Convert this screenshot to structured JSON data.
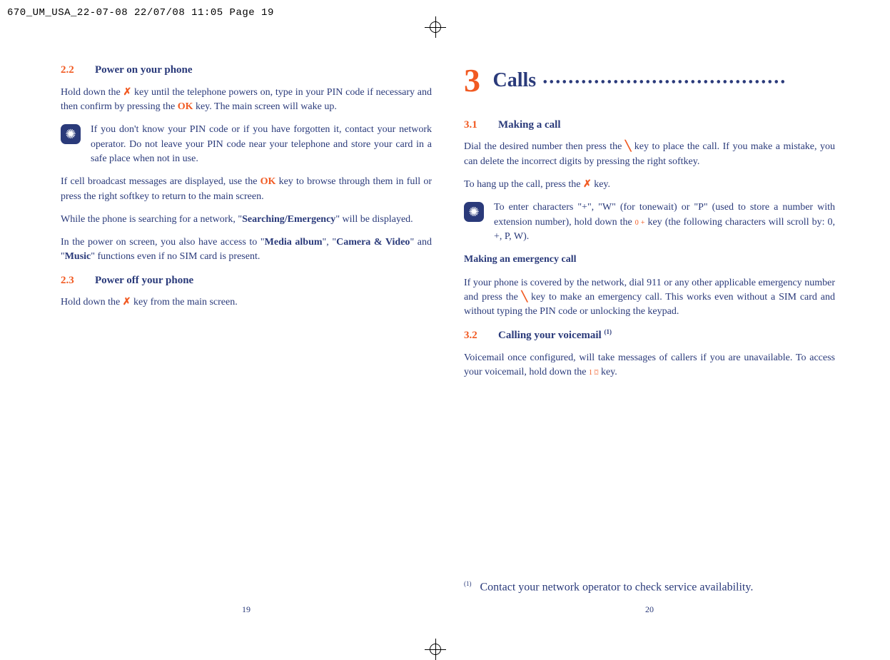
{
  "header": "670_UM_USA_22-07-08  22/07/08  11:05  Page 19",
  "left": {
    "s22": {
      "num": "2.2",
      "title": "Power on your phone",
      "p1a": "Hold down the ",
      "p1_key": "✗",
      "p1b": " key until the telephone powers on, type in your PIN code if necessary and then confirm by pressing the ",
      "p1_ok": "OK",
      "p1c": " key. The main screen will wake up.",
      "tip1": "If you don't know your PIN code or if you have forgotten it, contact your network operator. Do not leave your PIN code near your telephone and store your card in a safe place when not in use.",
      "p2a": "If cell broadcast messages are displayed, use the ",
      "p2_ok": "OK",
      "p2b": " key to browse through them in full or press the right softkey to return to the main screen.",
      "p3a": "While the phone is searching for a network, \"",
      "p3_bold": "Searching/Emergency",
      "p3b": "\" will be displayed.",
      "p4a": "In the power on screen, you also have access to \"",
      "p4_b1": "Media album",
      "p4b": "\", \"",
      "p4_b2": "Camera & Video",
      "p4c": "\" and \"",
      "p4_b3": "Music",
      "p4d": "\" functions even if no SIM card is present."
    },
    "s23": {
      "num": "2.3",
      "title": "Power off your phone",
      "p1a": "Hold down the ",
      "p1_key": "✗",
      "p1b": " key from the main screen."
    },
    "pagenum": "19"
  },
  "right": {
    "ch": {
      "num": "3",
      "title": "Calls",
      "dots": "  ......................................"
    },
    "s31": {
      "num": "3.1",
      "title": "Making a call",
      "p1a": "Dial the desired number then press the ",
      "p1_key": "╲",
      "p1b": " key to place the call. If you make a mistake, you can delete the incorrect digits by pressing the right softkey.",
      "p2a": "To hang up the call, press the ",
      "p2_key": "✗",
      "p2b": " key.",
      "tip1a": "To enter characters \"+\", \"W\" (for tonewait) or \"P\" (used to store a number with extension number), hold down the ",
      "tip1_key": "0 +",
      "tip1b": " key (the following characters will scroll by: 0, +, P, W).",
      "h_emerg": "Making an emergency call",
      "p3a": "If your phone is covered by the network, dial 911 or any other applicable emergency number and press the ",
      "p3_key": "╲",
      "p3b": " key to make an emergency call.  This works even without a SIM card and without typing the PIN code or unlocking the keypad."
    },
    "s32": {
      "num": "3.2",
      "title_a": "Calling your voicemail ",
      "title_sup": "(1)",
      "p1a": "Voicemail once configured, will take messages of callers if you are unavailable. To access your voicemail, hold down the ",
      "p1_key": "1 ⌼",
      "p1b": " key."
    },
    "foot_sup": "(1)",
    "foot_txt": "Contact your network operator to check service availability.",
    "pagenum": "20"
  },
  "icons": {
    "bulb": "✺"
  }
}
